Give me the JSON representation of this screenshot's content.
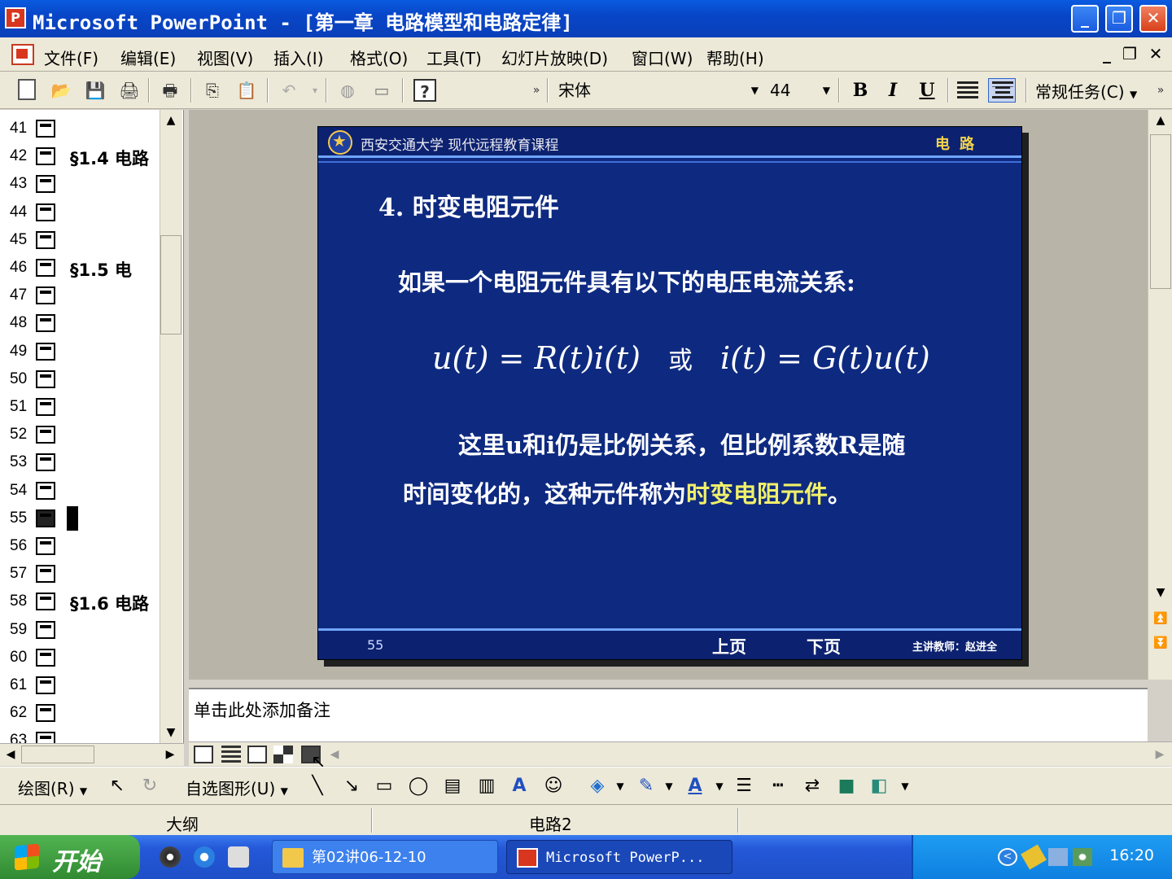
{
  "window": {
    "title": "Microsoft PowerPoint - [第一章 电路模型和电路定律]",
    "app_icon": "powerpoint-icon"
  },
  "menu": {
    "items": [
      "文件(F)",
      "编辑(E)",
      "视图(V)",
      "插入(I)",
      "格式(O)",
      "工具(T)",
      "幻灯片放映(D)",
      "窗口(W)",
      "帮助(H)"
    ]
  },
  "toolbar": {
    "font_name": "宋体",
    "font_size": "44",
    "task_pane": "常规任务(C)"
  },
  "outline": {
    "rows": [
      {
        "num": "41",
        "text": ""
      },
      {
        "num": "42",
        "text": "§1.4  电路"
      },
      {
        "num": "43",
        "text": ""
      },
      {
        "num": "44",
        "text": ""
      },
      {
        "num": "45",
        "text": ""
      },
      {
        "num": "46",
        "text": "§1.5  电"
      },
      {
        "num": "47",
        "text": ""
      },
      {
        "num": "48",
        "text": ""
      },
      {
        "num": "49",
        "text": ""
      },
      {
        "num": "50",
        "text": ""
      },
      {
        "num": "51",
        "text": ""
      },
      {
        "num": "52",
        "text": ""
      },
      {
        "num": "53",
        "text": ""
      },
      {
        "num": "54",
        "text": ""
      },
      {
        "num": "55",
        "text": ""
      },
      {
        "num": "56",
        "text": ""
      },
      {
        "num": "57",
        "text": ""
      },
      {
        "num": "58",
        "text": "§1.6  电路"
      },
      {
        "num": "59",
        "text": ""
      },
      {
        "num": "60",
        "text": ""
      },
      {
        "num": "61",
        "text": ""
      },
      {
        "num": "62",
        "text": ""
      },
      {
        "num": "63",
        "text": ""
      }
    ],
    "selected": "55"
  },
  "slide": {
    "school": "西安交通大学  现代远程教育课程",
    "subject": "电路",
    "title": "4. 时变电阻元件",
    "line1": "如果一个电阻元件具有以下的电压电流关系:",
    "eq_left": "u(t) = R(t)i(t)",
    "eq_or": "或",
    "eq_right": "i(t) = G(t)u(t)",
    "line2": "这里u和i仍是比例关系，但比例系数R是随",
    "line3_a": "时间变化的，这种元件称为",
    "line3_b": "时变电阻元件",
    "line3_c": "。",
    "page_num": "55",
    "prev": "上页",
    "next": "下页",
    "teacher": "主讲教师：赵进全",
    "colors": {
      "background": "#0e2a80",
      "highlight": "#f0f06a",
      "subject": "#f3d34b"
    }
  },
  "notes": {
    "placeholder": "单击此处添加备注"
  },
  "drawing": {
    "draw_menu": "绘图(R)",
    "autoshapes": "自选图形(U)"
  },
  "status": {
    "view": "大纲",
    "design": "电路2"
  },
  "taskbar": {
    "start": "开始",
    "tasks": [
      "第02讲06-12-10",
      "Microsoft PowerP..."
    ],
    "clock": "16:20"
  }
}
